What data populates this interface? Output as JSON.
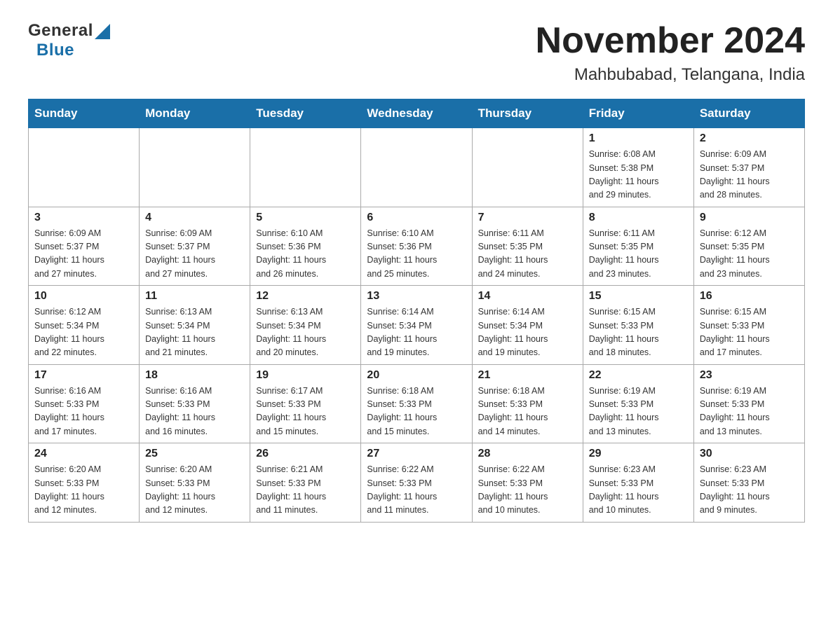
{
  "header": {
    "logo_general": "General",
    "logo_blue": "Blue",
    "month_title": "November 2024",
    "location": "Mahbubabad, Telangana, India"
  },
  "weekdays": [
    "Sunday",
    "Monday",
    "Tuesday",
    "Wednesday",
    "Thursday",
    "Friday",
    "Saturday"
  ],
  "weeks": [
    [
      {
        "day": "",
        "info": ""
      },
      {
        "day": "",
        "info": ""
      },
      {
        "day": "",
        "info": ""
      },
      {
        "day": "",
        "info": ""
      },
      {
        "day": "",
        "info": ""
      },
      {
        "day": "1",
        "info": "Sunrise: 6:08 AM\nSunset: 5:38 PM\nDaylight: 11 hours\nand 29 minutes."
      },
      {
        "day": "2",
        "info": "Sunrise: 6:09 AM\nSunset: 5:37 PM\nDaylight: 11 hours\nand 28 minutes."
      }
    ],
    [
      {
        "day": "3",
        "info": "Sunrise: 6:09 AM\nSunset: 5:37 PM\nDaylight: 11 hours\nand 27 minutes."
      },
      {
        "day": "4",
        "info": "Sunrise: 6:09 AM\nSunset: 5:37 PM\nDaylight: 11 hours\nand 27 minutes."
      },
      {
        "day": "5",
        "info": "Sunrise: 6:10 AM\nSunset: 5:36 PM\nDaylight: 11 hours\nand 26 minutes."
      },
      {
        "day": "6",
        "info": "Sunrise: 6:10 AM\nSunset: 5:36 PM\nDaylight: 11 hours\nand 25 minutes."
      },
      {
        "day": "7",
        "info": "Sunrise: 6:11 AM\nSunset: 5:35 PM\nDaylight: 11 hours\nand 24 minutes."
      },
      {
        "day": "8",
        "info": "Sunrise: 6:11 AM\nSunset: 5:35 PM\nDaylight: 11 hours\nand 23 minutes."
      },
      {
        "day": "9",
        "info": "Sunrise: 6:12 AM\nSunset: 5:35 PM\nDaylight: 11 hours\nand 23 minutes."
      }
    ],
    [
      {
        "day": "10",
        "info": "Sunrise: 6:12 AM\nSunset: 5:34 PM\nDaylight: 11 hours\nand 22 minutes."
      },
      {
        "day": "11",
        "info": "Sunrise: 6:13 AM\nSunset: 5:34 PM\nDaylight: 11 hours\nand 21 minutes."
      },
      {
        "day": "12",
        "info": "Sunrise: 6:13 AM\nSunset: 5:34 PM\nDaylight: 11 hours\nand 20 minutes."
      },
      {
        "day": "13",
        "info": "Sunrise: 6:14 AM\nSunset: 5:34 PM\nDaylight: 11 hours\nand 19 minutes."
      },
      {
        "day": "14",
        "info": "Sunrise: 6:14 AM\nSunset: 5:34 PM\nDaylight: 11 hours\nand 19 minutes."
      },
      {
        "day": "15",
        "info": "Sunrise: 6:15 AM\nSunset: 5:33 PM\nDaylight: 11 hours\nand 18 minutes."
      },
      {
        "day": "16",
        "info": "Sunrise: 6:15 AM\nSunset: 5:33 PM\nDaylight: 11 hours\nand 17 minutes."
      }
    ],
    [
      {
        "day": "17",
        "info": "Sunrise: 6:16 AM\nSunset: 5:33 PM\nDaylight: 11 hours\nand 17 minutes."
      },
      {
        "day": "18",
        "info": "Sunrise: 6:16 AM\nSunset: 5:33 PM\nDaylight: 11 hours\nand 16 minutes."
      },
      {
        "day": "19",
        "info": "Sunrise: 6:17 AM\nSunset: 5:33 PM\nDaylight: 11 hours\nand 15 minutes."
      },
      {
        "day": "20",
        "info": "Sunrise: 6:18 AM\nSunset: 5:33 PM\nDaylight: 11 hours\nand 15 minutes."
      },
      {
        "day": "21",
        "info": "Sunrise: 6:18 AM\nSunset: 5:33 PM\nDaylight: 11 hours\nand 14 minutes."
      },
      {
        "day": "22",
        "info": "Sunrise: 6:19 AM\nSunset: 5:33 PM\nDaylight: 11 hours\nand 13 minutes."
      },
      {
        "day": "23",
        "info": "Sunrise: 6:19 AM\nSunset: 5:33 PM\nDaylight: 11 hours\nand 13 minutes."
      }
    ],
    [
      {
        "day": "24",
        "info": "Sunrise: 6:20 AM\nSunset: 5:33 PM\nDaylight: 11 hours\nand 12 minutes."
      },
      {
        "day": "25",
        "info": "Sunrise: 6:20 AM\nSunset: 5:33 PM\nDaylight: 11 hours\nand 12 minutes."
      },
      {
        "day": "26",
        "info": "Sunrise: 6:21 AM\nSunset: 5:33 PM\nDaylight: 11 hours\nand 11 minutes."
      },
      {
        "day": "27",
        "info": "Sunrise: 6:22 AM\nSunset: 5:33 PM\nDaylight: 11 hours\nand 11 minutes."
      },
      {
        "day": "28",
        "info": "Sunrise: 6:22 AM\nSunset: 5:33 PM\nDaylight: 11 hours\nand 10 minutes."
      },
      {
        "day": "29",
        "info": "Sunrise: 6:23 AM\nSunset: 5:33 PM\nDaylight: 11 hours\nand 10 minutes."
      },
      {
        "day": "30",
        "info": "Sunrise: 6:23 AM\nSunset: 5:33 PM\nDaylight: 11 hours\nand 9 minutes."
      }
    ]
  ]
}
